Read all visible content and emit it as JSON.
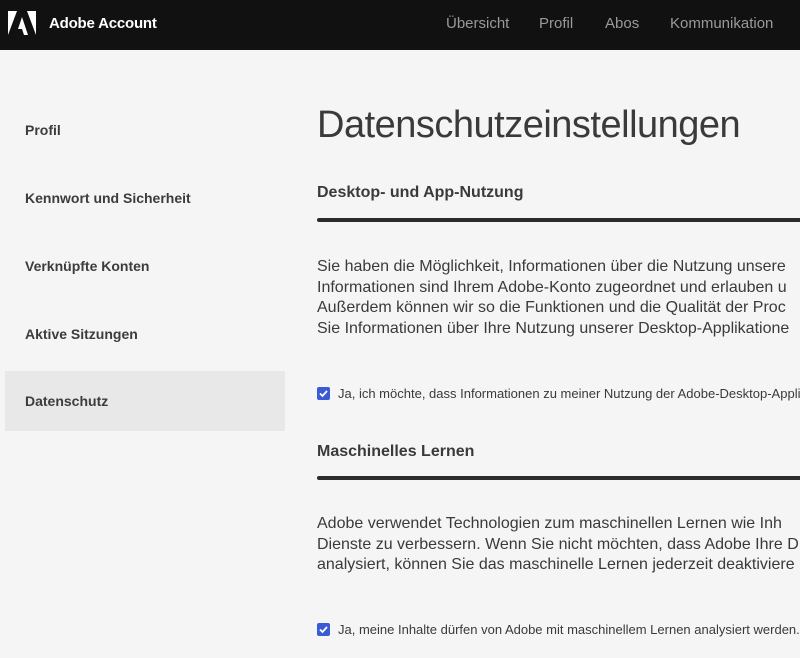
{
  "header": {
    "app_title": "Adobe Account",
    "nav": [
      {
        "label": "Übersicht"
      },
      {
        "label": "Profil"
      },
      {
        "label": "Abos"
      },
      {
        "label": "Kommunikation"
      }
    ]
  },
  "sidebar": {
    "items": [
      {
        "label": "Profil",
        "active": false
      },
      {
        "label": "Kennwort und Sicherheit",
        "active": false
      },
      {
        "label": "Verknüpfte Konten",
        "active": false
      },
      {
        "label": "Aktive Sitzungen",
        "active": false
      },
      {
        "label": "Datenschutz",
        "active": true
      }
    ]
  },
  "main": {
    "title": "Datenschutzeinstellungen",
    "sections": [
      {
        "heading": "Desktop- und App-Nutzung",
        "paragraph_lines": [
          "Sie haben die Möglichkeit, Informationen über die Nutzung unsere",
          "Informationen sind Ihrem Adobe-Konto zugeordnet und erlauben u",
          "Außerdem können wir so die Funktionen und die Qualität der Proc",
          "Sie Informationen über Ihre Nutzung unserer Desktop-Applikatione"
        ],
        "checkbox_label": "Ja, ich möchte, dass Informationen zu meiner Nutzung der Adobe-Desktop-Applik",
        "checked": true
      },
      {
        "heading": "Maschinelles Lernen",
        "paragraph_lines": [
          "Adobe verwendet Technologien zum maschinellen Lernen wie Inh",
          "Dienste zu verbessern. Wenn Sie nicht möchten, dass Adobe Ihre D",
          "analysiert, können Sie das maschinelle Lernen jederzeit deaktiviere"
        ],
        "checkbox_label": "Ja, meine Inhalte dürfen von Adobe mit maschinellem Lernen analysiert werden.",
        "checked": true
      }
    ]
  },
  "colors": {
    "header_bg": "#111111",
    "accent_checkbox": "#3a5bd4",
    "active_sidebar_bg": "#e8e8e8",
    "page_bg": "#f5f5f5"
  }
}
